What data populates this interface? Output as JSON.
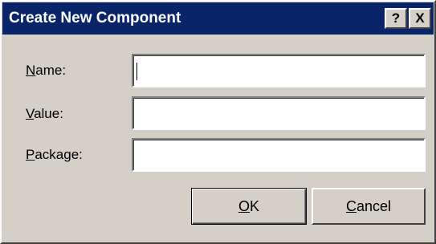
{
  "window": {
    "title": "Create New Component",
    "help_label": "?",
    "close_label": "X"
  },
  "fields": {
    "name": {
      "accel": "N",
      "rest": "ame:",
      "value": ""
    },
    "value": {
      "accel": "V",
      "rest": "alue:",
      "value": ""
    },
    "package": {
      "accel": "P",
      "rest": "ackage:",
      "value": ""
    }
  },
  "buttons": {
    "ok": {
      "accel": "O",
      "rest": "K"
    },
    "cancel": {
      "accel": "C",
      "rest": "ancel"
    }
  },
  "colors": {
    "titlebar": "#0a246a",
    "dialog_face": "#d4d0c8"
  }
}
